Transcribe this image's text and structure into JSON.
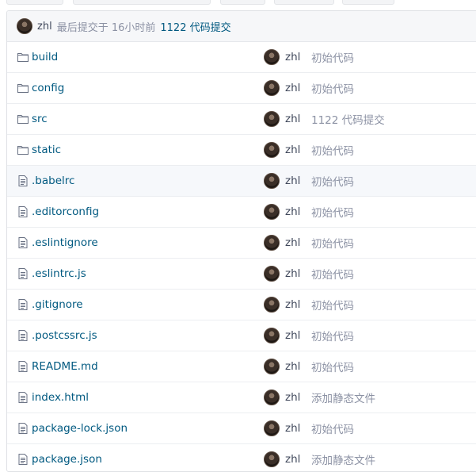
{
  "commit": {
    "author": "zhl",
    "meta": "最后提交于 16小时前",
    "message": "1122 代码提交"
  },
  "files": [
    {
      "name": "build",
      "type": "folder",
      "author": "zhl",
      "message": "初始代码"
    },
    {
      "name": "config",
      "type": "folder",
      "author": "zhl",
      "message": "初始代码"
    },
    {
      "name": "src",
      "type": "folder",
      "author": "zhl",
      "message": "1122 代码提交"
    },
    {
      "name": "static",
      "type": "folder",
      "author": "zhl",
      "message": "初始代码"
    },
    {
      "name": ".babelrc",
      "type": "file",
      "author": "zhl",
      "message": "初始代码"
    },
    {
      "name": ".editorconfig",
      "type": "file",
      "author": "zhl",
      "message": "初始代码"
    },
    {
      "name": ".eslintignore",
      "type": "file",
      "author": "zhl",
      "message": "初始代码"
    },
    {
      "name": ".eslintrc.js",
      "type": "file",
      "author": "zhl",
      "message": "初始代码"
    },
    {
      "name": ".gitignore",
      "type": "file",
      "author": "zhl",
      "message": "初始代码"
    },
    {
      "name": ".postcssrc.js",
      "type": "file",
      "author": "zhl",
      "message": "初始代码"
    },
    {
      "name": "README.md",
      "type": "file",
      "author": "zhl",
      "message": "初始代码"
    },
    {
      "name": "index.html",
      "type": "file",
      "author": "zhl",
      "message": "添加静态文件"
    },
    {
      "name": "package-lock.json",
      "type": "file",
      "author": "zhl",
      "message": "初始代码"
    },
    {
      "name": "package.json",
      "type": "file",
      "author": "zhl",
      "message": "添加静态文件"
    }
  ]
}
